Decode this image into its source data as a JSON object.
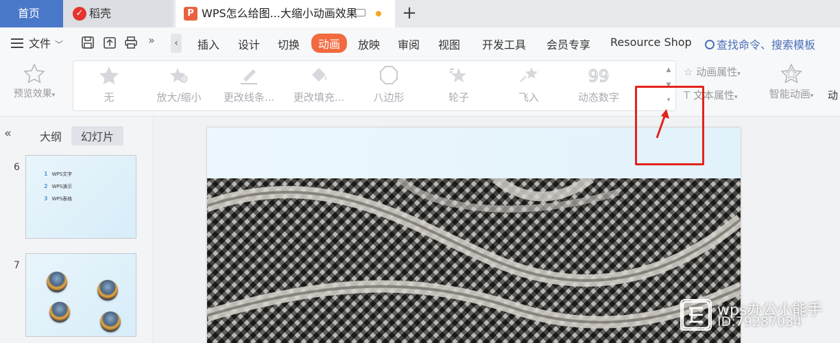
{
  "tabs": {
    "home": "首页",
    "daoke": "稻壳",
    "document": "WPS怎么给图...大缩小动画效果",
    "add_symbol": "+"
  },
  "menubar": {
    "file": "文件",
    "more_symbol": "»",
    "collapse_symbol": "‹",
    "items": [
      "插入",
      "设计",
      "切换",
      "动画",
      "放映",
      "审阅",
      "视图",
      "开发工具",
      "会员专享",
      "Resource Shop"
    ],
    "active_item": "动画",
    "search": "查找命令、搜索模板"
  },
  "ribbon": {
    "preview_label": "预览效果",
    "gallery": [
      "无",
      "放大/缩小",
      "更改线条...",
      "更改填充...",
      "八边形",
      "轮子",
      "飞入",
      "动态数字"
    ],
    "anim_props": "动画属性",
    "text_props": "文本属性",
    "smart_anim": "智能动画",
    "truncated_label": "动"
  },
  "panel": {
    "collapse_symbol": "«",
    "tabs": [
      "大纲",
      "幻灯片"
    ],
    "active_tab": "幻灯片",
    "slides": [
      {
        "number": "6",
        "lines": [
          {
            "n": "1",
            "text": "WPS文字"
          },
          {
            "n": "2",
            "text": "WPS演示"
          },
          {
            "n": "3",
            "text": "WPS表格"
          }
        ]
      },
      {
        "number": "7"
      }
    ]
  },
  "watermark": {
    "line1": "wps办公小能手",
    "line2": "ID:79287034"
  },
  "colors": {
    "home_tab": "#4a78c9",
    "active_menu": "#f26a3f",
    "annotation": "#e2231a"
  }
}
